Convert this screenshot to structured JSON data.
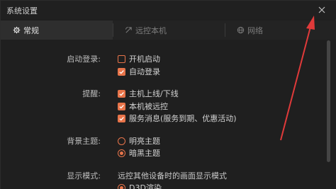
{
  "window": {
    "title": "系统设置"
  },
  "tabs": [
    {
      "label": "常规",
      "icon": "gear-icon"
    },
    {
      "label": "远控本机",
      "icon": "remote-icon"
    },
    {
      "label": "网络",
      "icon": "network-icon"
    }
  ],
  "startup": {
    "label": "启动登录:",
    "options": [
      {
        "label": "开机启动",
        "checked": false
      },
      {
        "label": "自动登录",
        "checked": true
      }
    ]
  },
  "reminder": {
    "label": "提醒:",
    "options": [
      {
        "label": "主机上线/下线",
        "checked": true
      },
      {
        "label": "本机被远控",
        "checked": true
      },
      {
        "label": "服务消息(服务到期、优惠活动)",
        "checked": true
      }
    ]
  },
  "theme": {
    "label": "背景主题:",
    "options": [
      {
        "label": "明亮主题",
        "selected": false
      },
      {
        "label": "暗黑主题",
        "selected": true
      }
    ]
  },
  "display": {
    "label": "显示模式:",
    "description": "远控其他设备时的画面显示模式",
    "options": [
      {
        "label": "D3D渲染",
        "selected": true
      }
    ]
  },
  "colors": {
    "accent": "#e8744a",
    "annotation_arrow": "#e03a3a",
    "background": "#1f1f1f"
  }
}
